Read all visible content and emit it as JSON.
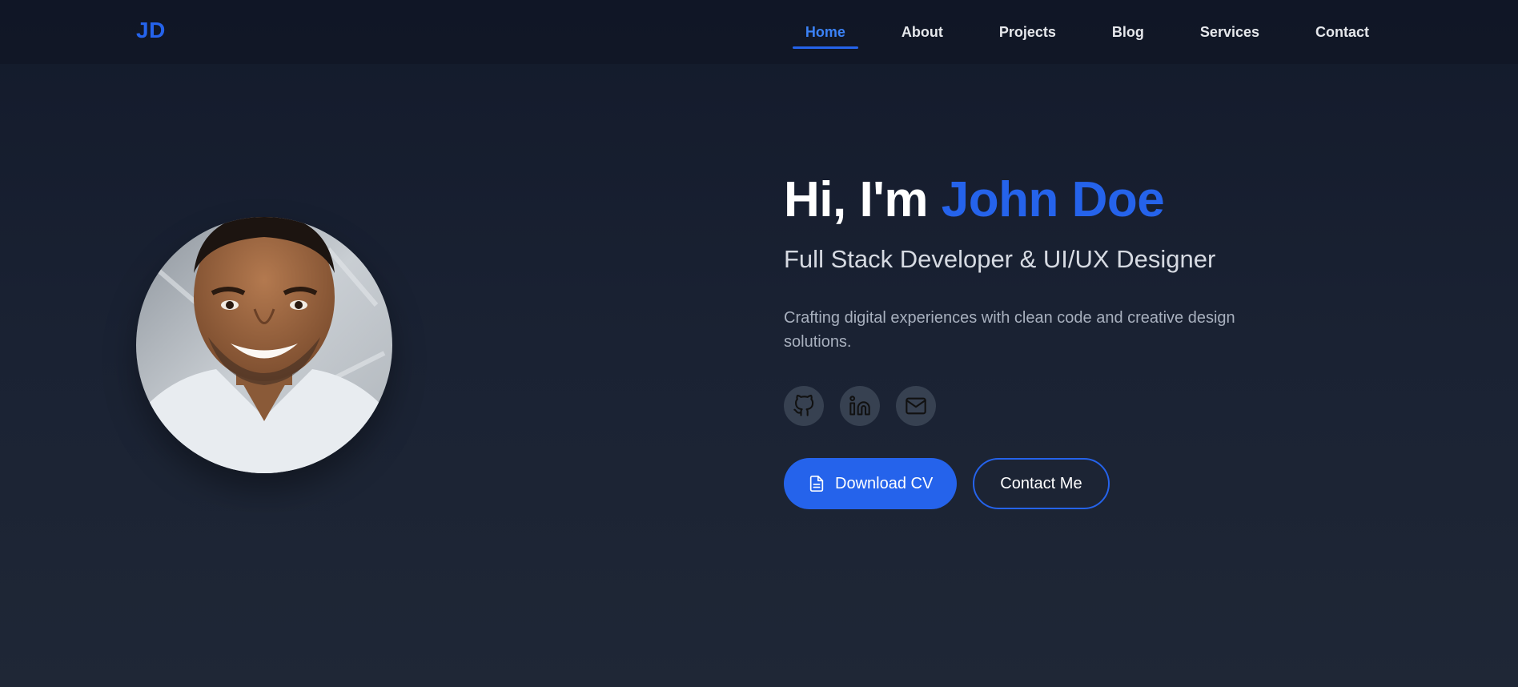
{
  "brand": {
    "logo": "JD",
    "accent": "#2563eb"
  },
  "nav": {
    "items": [
      {
        "label": "Home",
        "active": true
      },
      {
        "label": "About"
      },
      {
        "label": "Projects"
      },
      {
        "label": "Blog"
      },
      {
        "label": "Services"
      },
      {
        "label": "Contact"
      }
    ]
  },
  "hero": {
    "greeting": "Hi, I'm",
    "name": "John Doe",
    "subtitle": "Full Stack Developer & UI/UX Designer",
    "description": "Crafting digital experiences with clean code and creative design solutions.",
    "avatar": "profile-photo",
    "socials": [
      {
        "icon": "github-icon"
      },
      {
        "icon": "linkedin-icon"
      },
      {
        "icon": "mail-icon"
      }
    ],
    "buttons": {
      "download_cv": {
        "label": "Download CV",
        "icon": "file-icon"
      },
      "contact_me": {
        "label": "Contact Me"
      }
    }
  }
}
